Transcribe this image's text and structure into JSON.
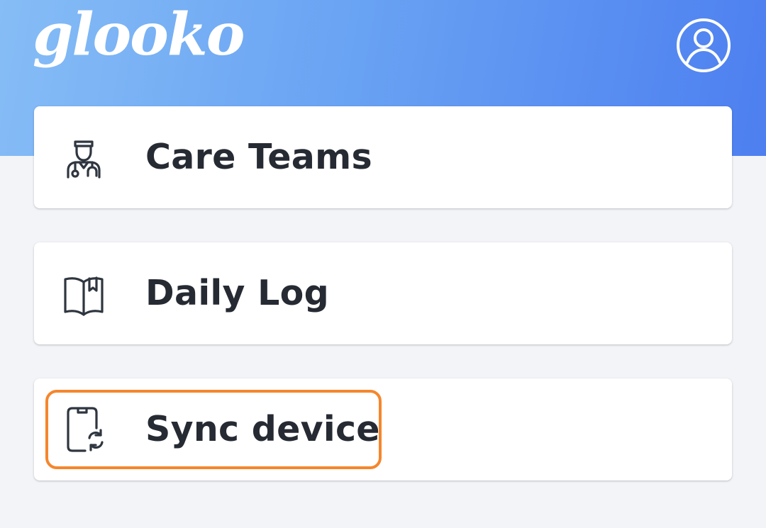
{
  "header": {
    "logo_text": "glooko",
    "profile_icon": "user-circle-icon"
  },
  "menu": {
    "items": [
      {
        "label": "Care Teams",
        "icon": "doctor-icon"
      },
      {
        "label": "Daily Log",
        "icon": "book-icon"
      },
      {
        "label": "Sync device",
        "icon": "phone-sync-icon",
        "highlighted": true
      }
    ]
  },
  "colors": {
    "header_gradient_start": "#86bdf6",
    "header_gradient_end": "#4d7ff0",
    "background": "#f3f4f8",
    "card": "#ffffff",
    "text": "#262a33",
    "icon": "#2f3640",
    "highlight": "#f5862c"
  }
}
